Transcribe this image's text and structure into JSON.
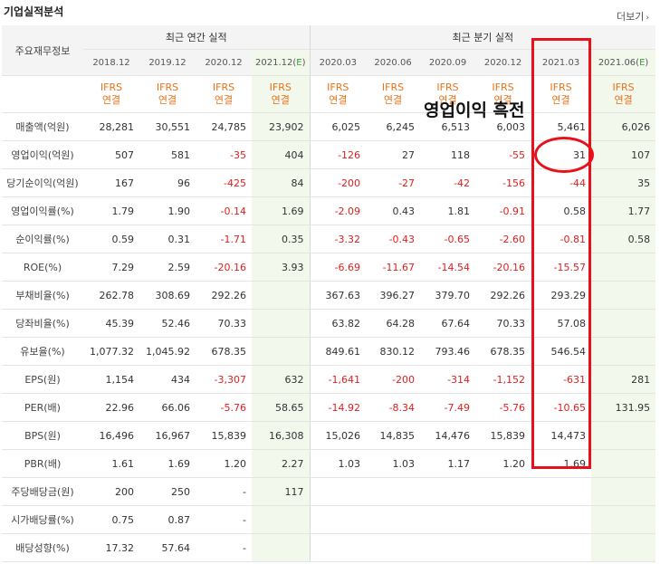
{
  "header": {
    "title": "기업실적분석",
    "more_label": "더보기"
  },
  "groups": {
    "label_col": "주요재무정보",
    "annual": "최근 연간 실적",
    "quarterly": "최근 분기 실적"
  },
  "periods": [
    "2018.12",
    "2019.12",
    "2020.12",
    "2021.12(E)",
    "2020.03",
    "2020.06",
    "2020.09",
    "2020.12",
    "2021.03",
    "2021.06(E)"
  ],
  "ifrs": [
    "IFRS",
    "연결"
  ],
  "rows": [
    {
      "label": "매출액(억원)",
      "values": [
        "28,281",
        "30,551",
        "24,785",
        "23,902",
        "6,025",
        "6,245",
        "6,513",
        "6,003",
        "5,461",
        "6,026"
      ]
    },
    {
      "label": "영업이익(억원)",
      "values": [
        "507",
        "581",
        "-35",
        "404",
        "-126",
        "27",
        "118",
        "-55",
        "31",
        "107"
      ]
    },
    {
      "label": "당기순이익(억원)",
      "values": [
        "167",
        "96",
        "-425",
        "84",
        "-200",
        "-27",
        "-42",
        "-156",
        "-44",
        "35"
      ]
    },
    {
      "label": "영업이익률(%)",
      "values": [
        "1.79",
        "1.90",
        "-0.14",
        "1.69",
        "-2.09",
        "0.43",
        "1.81",
        "-0.91",
        "0.58",
        "1.77"
      ]
    },
    {
      "label": "순이익률(%)",
      "values": [
        "0.59",
        "0.31",
        "-1.71",
        "0.35",
        "-3.32",
        "-0.43",
        "-0.65",
        "-2.60",
        "-0.81",
        "0.58"
      ]
    },
    {
      "label": "ROE(%)",
      "values": [
        "7.29",
        "2.59",
        "-20.16",
        "3.93",
        "-6.69",
        "-11.67",
        "-14.54",
        "-20.16",
        "-15.57",
        ""
      ]
    },
    {
      "label": "부채비율(%)",
      "values": [
        "262.78",
        "308.69",
        "292.26",
        "",
        "367.63",
        "396.27",
        "379.70",
        "292.26",
        "293.29",
        ""
      ]
    },
    {
      "label": "당좌비율(%)",
      "values": [
        "45.39",
        "52.46",
        "70.33",
        "",
        "63.82",
        "64.28",
        "67.64",
        "70.33",
        "57.08",
        ""
      ]
    },
    {
      "label": "유보율(%)",
      "values": [
        "1,077.32",
        "1,045.92",
        "678.35",
        "",
        "849.61",
        "830.12",
        "793.46",
        "678.35",
        "546.54",
        ""
      ]
    },
    {
      "label": "EPS(원)",
      "values": [
        "1,154",
        "434",
        "-3,307",
        "632",
        "-1,641",
        "-200",
        "-314",
        "-1,152",
        "-631",
        "281"
      ]
    },
    {
      "label": "PER(배)",
      "values": [
        "22.96",
        "66.06",
        "-5.76",
        "58.65",
        "-14.92",
        "-8.34",
        "-7.49",
        "-5.76",
        "-10.65",
        "131.95"
      ]
    },
    {
      "label": "BPS(원)",
      "values": [
        "16,496",
        "16,967",
        "15,839",
        "16,308",
        "15,026",
        "14,835",
        "14,476",
        "15,839",
        "14,473",
        ""
      ]
    },
    {
      "label": "PBR(배)",
      "values": [
        "1.61",
        "1.69",
        "1.20",
        "2.27",
        "1.03",
        "1.03",
        "1.17",
        "1.20",
        "1.69",
        ""
      ]
    },
    {
      "label": "주당배당금(원)",
      "values": [
        "200",
        "250",
        "-",
        "117",
        "",
        "",
        "",
        "",
        "",
        ""
      ]
    },
    {
      "label": "시가배당률(%)",
      "values": [
        "0.75",
        "0.87",
        "-",
        "",
        "",
        "",
        "",
        "",
        "",
        ""
      ]
    },
    {
      "label": "배당성향(%)",
      "values": [
        "17.32",
        "57.64",
        "-",
        "",
        "",
        "",
        "",
        "",
        "",
        ""
      ]
    }
  ],
  "annotation": {
    "text": "영업이익 흑전",
    "color": "#e8101a"
  },
  "colors": {
    "negative": "#e02020",
    "ifrs": "#e8731b",
    "estimate_bg": "#f3f8ec",
    "estimate_mark": "#3a9a3a"
  }
}
